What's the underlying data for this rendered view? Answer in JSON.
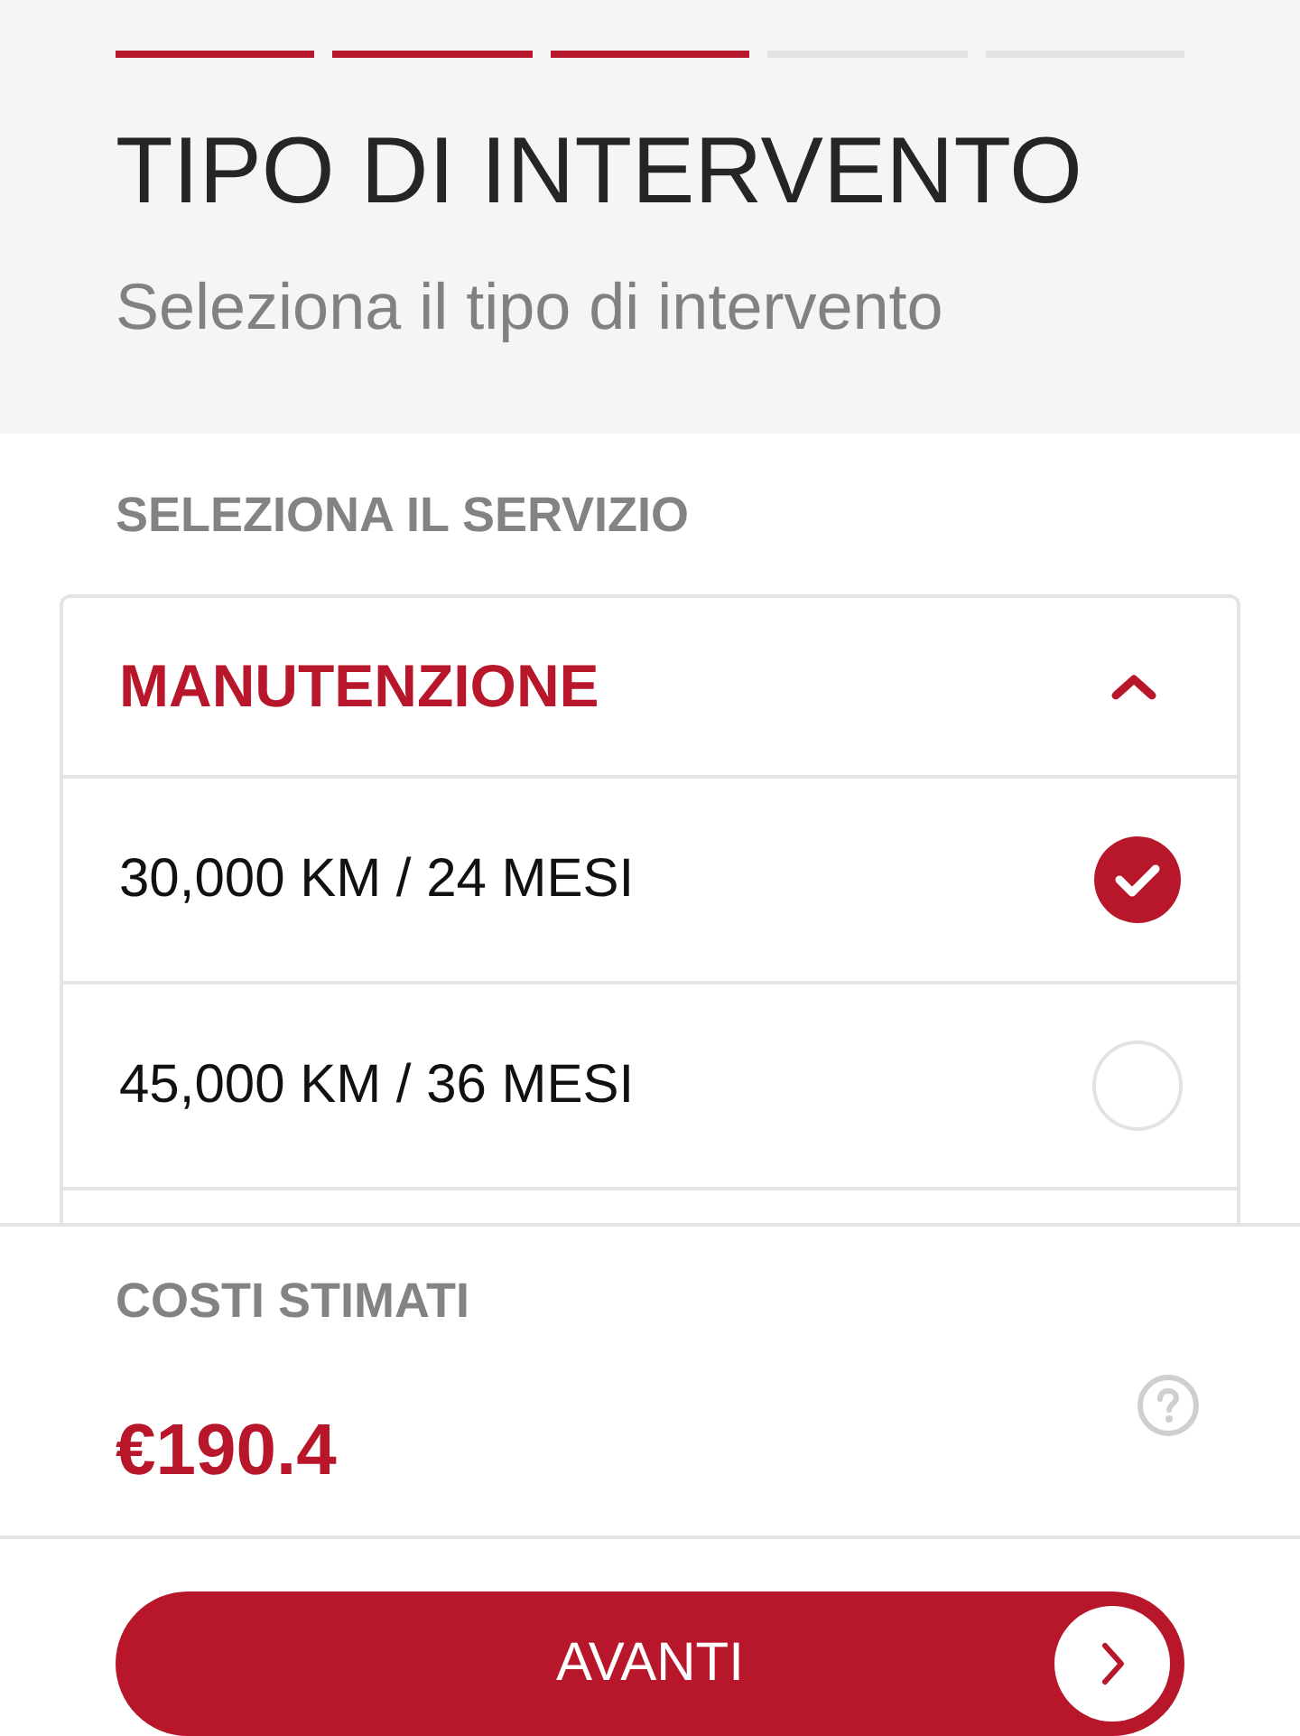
{
  "progress": [
    {
      "done": true
    },
    {
      "done": true
    },
    {
      "done": true
    },
    {
      "done": false
    },
    {
      "done": false
    }
  ],
  "title": "TIPO DI INTERVENTO",
  "subtitle": "Seleziona il tipo di intervento",
  "section_label": "SELEZIONA IL SERVIZIO",
  "accordion": {
    "title": "MANUTENZIONE",
    "expanded": true,
    "options": [
      {
        "label": "30,000 KM / 24 MESI",
        "selected": true
      },
      {
        "label": "45,000 KM / 36 MESI",
        "selected": false
      }
    ]
  },
  "footer": {
    "label": "COSTI STIMATI",
    "price": "€190.4"
  },
  "button": {
    "label": "AVANTI"
  }
}
